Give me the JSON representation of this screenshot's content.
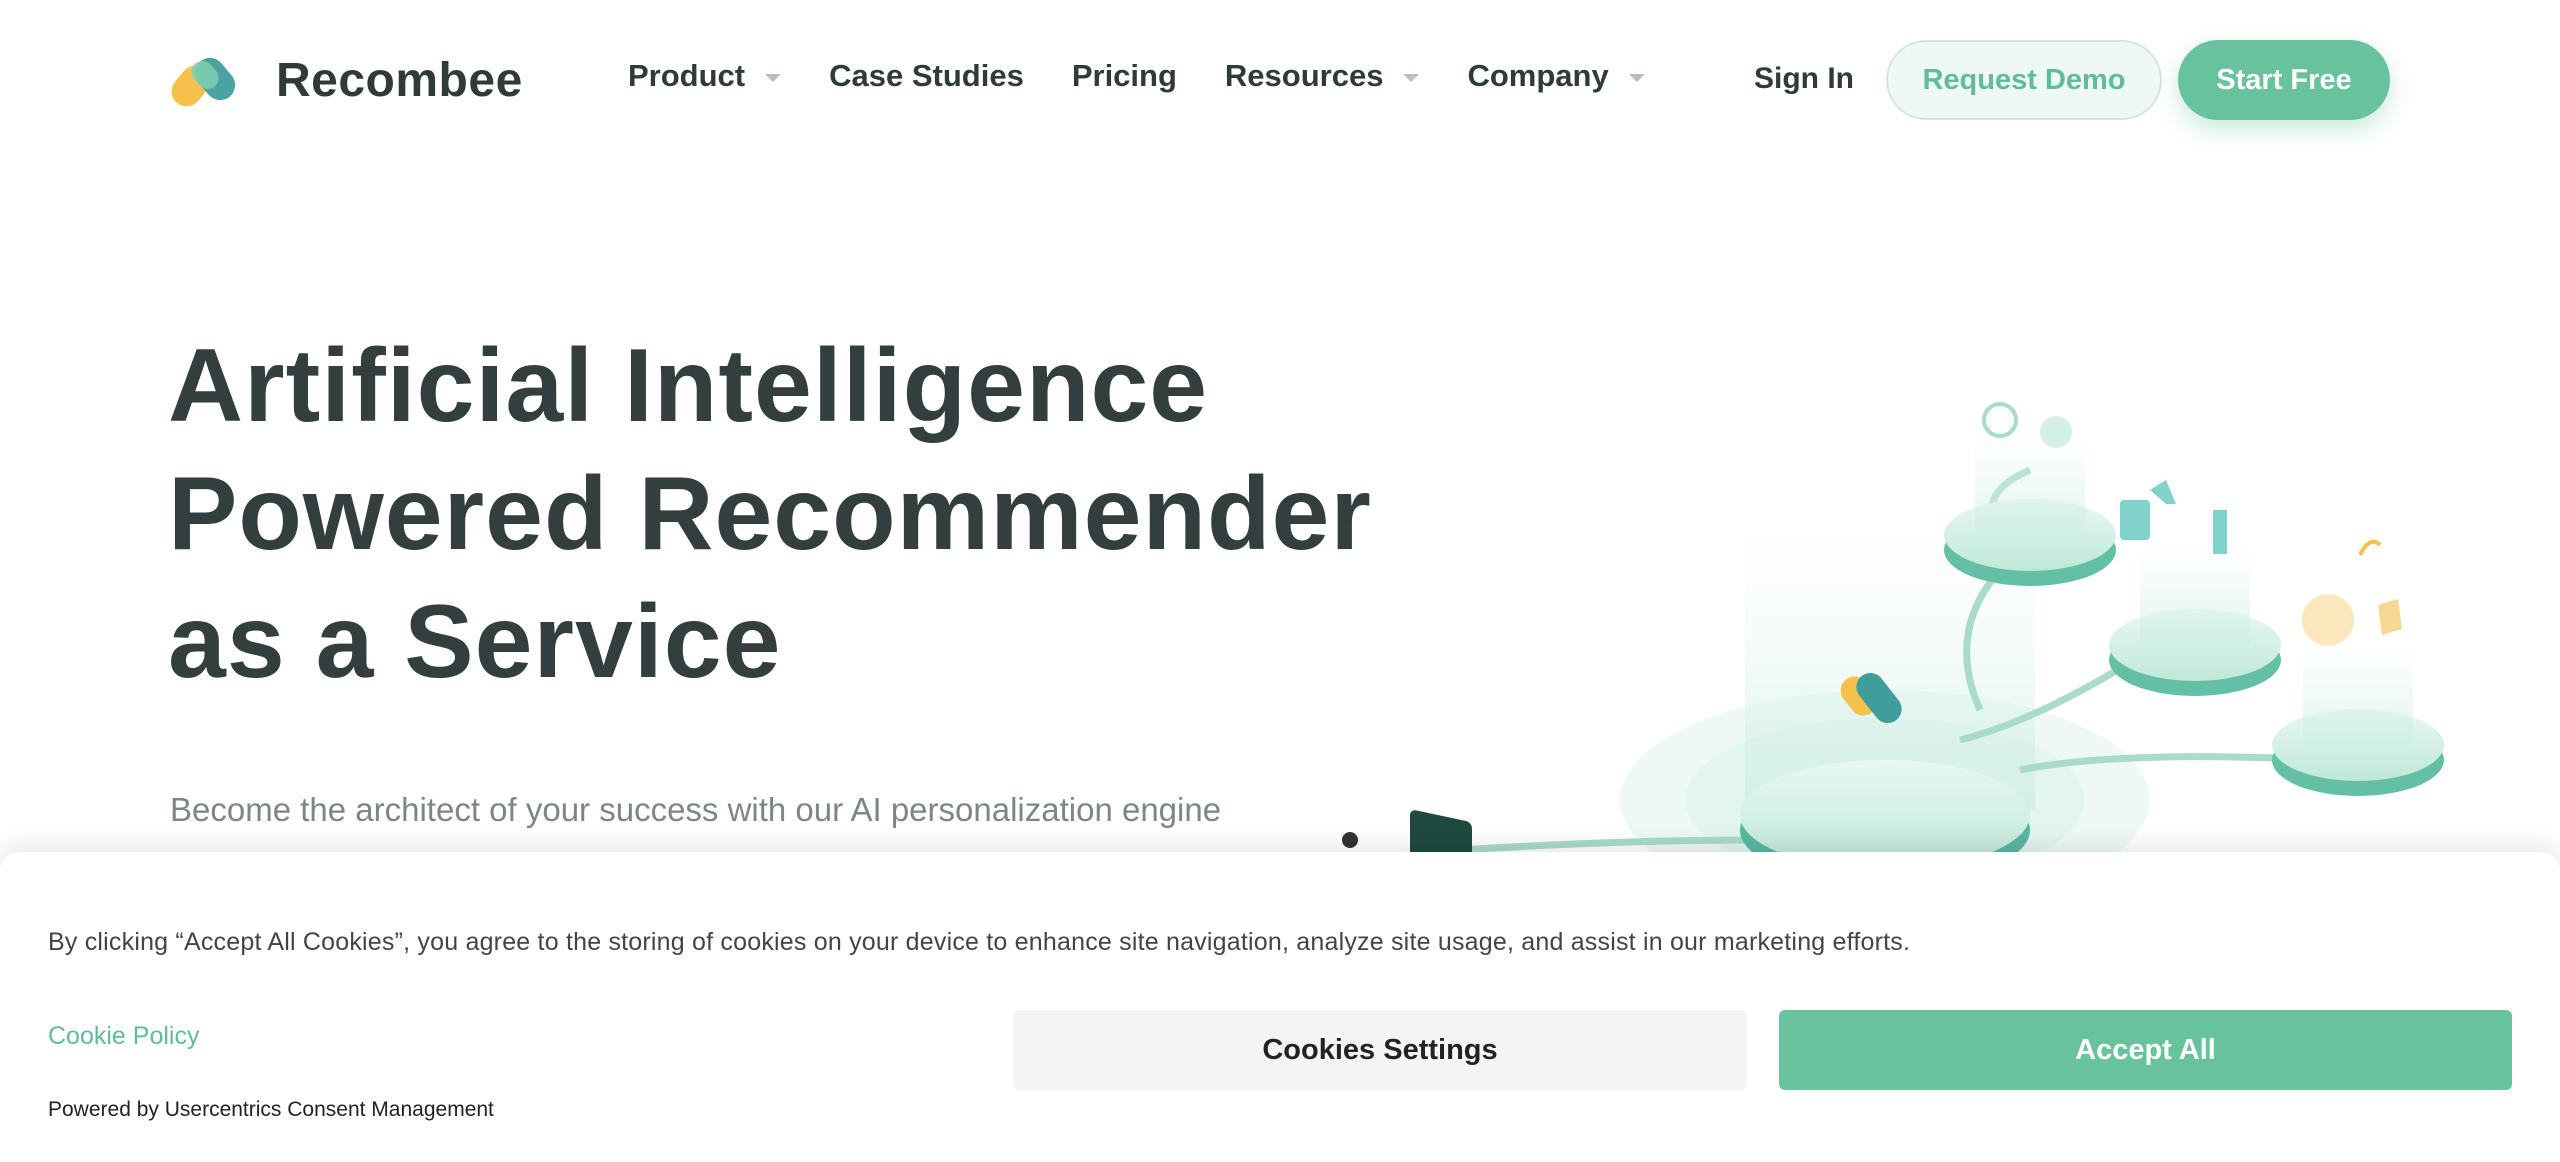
{
  "brand": {
    "name": "Recombee",
    "colors": {
      "yellow": "#f6c14a",
      "teal": "#3f9e9c",
      "green": "#68c29d"
    }
  },
  "nav": {
    "items": [
      {
        "label": "Product",
        "dropdown": true
      },
      {
        "label": "Case Studies",
        "dropdown": false
      },
      {
        "label": "Pricing",
        "dropdown": false
      },
      {
        "label": "Resources",
        "dropdown": true
      },
      {
        "label": "Company",
        "dropdown": true
      }
    ],
    "sign_in": "Sign In",
    "request_demo": "Request Demo",
    "start_free": "Start Free"
  },
  "hero": {
    "title_lines": [
      "Artificial Intelligence",
      "Powered Recommender",
      "as a Service"
    ],
    "subtitle": "Become the architect of your success with our AI personalization engine"
  },
  "cookie_banner": {
    "text": "By clicking “Accept All Cookies”, you agree to the storing of cookies on your device to enhance site navigation, analyze site usage, and assist in our marketing efforts.",
    "policy_link": "Cookie Policy",
    "powered_by": "Powered by Usercentrics Consent Management",
    "settings_button": "Cookies Settings",
    "accept_button": "Accept All"
  }
}
